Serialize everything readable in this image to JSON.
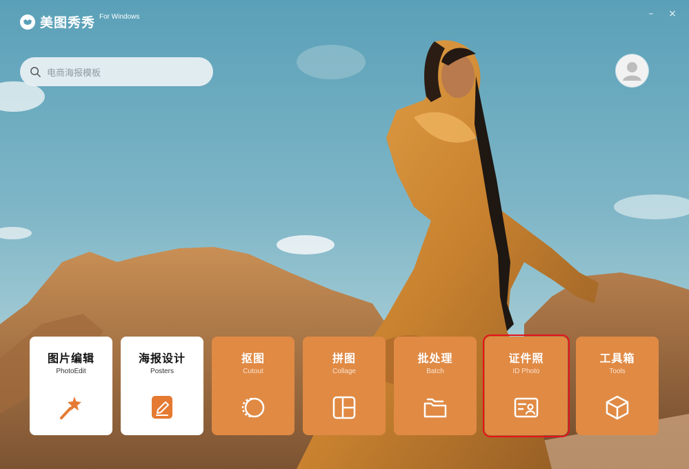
{
  "app": {
    "name": "美图秀秀",
    "platform": "For Windows",
    "logo_icon": "meitu-logo-icon"
  },
  "window": {
    "minimize_label": "–",
    "close_label": "×"
  },
  "search": {
    "placeholder": "电商海报模板",
    "value": "",
    "icon": "search-icon"
  },
  "user": {
    "icon": "user-avatar-icon"
  },
  "colors": {
    "tile_orange": "#e08a44",
    "tile_white": "#ffffff",
    "selection": "#e8111a",
    "icon_orange": "#e57a33"
  },
  "tiles": [
    {
      "title": "图片编辑",
      "subtitle": "PhotoEdit",
      "icon": "magic-wand-icon"
    },
    {
      "title": "海报设计",
      "subtitle": "Posters",
      "icon": "edit-pen-icon"
    },
    {
      "title": "抠图",
      "subtitle": "Cutout",
      "icon": "cutout-circle-icon"
    },
    {
      "title": "拼图",
      "subtitle": "Collage",
      "icon": "collage-grid-icon"
    },
    {
      "title": "批处理",
      "subtitle": "Batch",
      "icon": "folder-stack-icon"
    },
    {
      "title": "证件照",
      "subtitle": "ID Photo",
      "icon": "id-card-icon",
      "selected": true
    },
    {
      "title": "工具箱",
      "subtitle": "Tools",
      "icon": "cube-icon"
    }
  ]
}
